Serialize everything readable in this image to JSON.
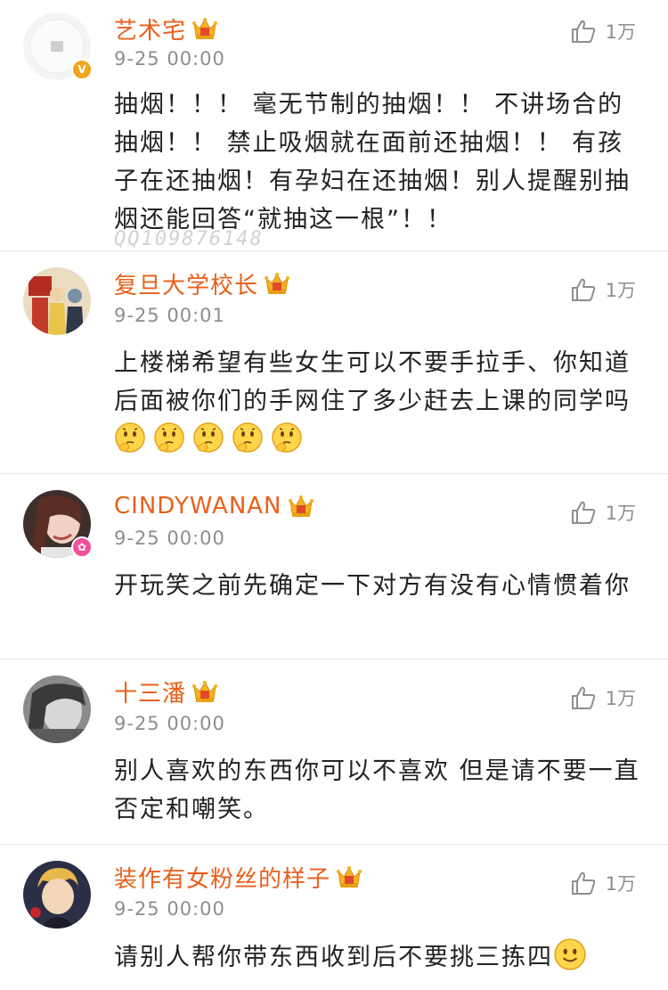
{
  "comments": [
    {
      "username": "艺术宅",
      "time": "9-25 00:00",
      "likes": "1万",
      "text": "抽烟！！！ 毫无节制的抽烟！！ 不讲场合的抽烟！！ 禁止吸烟就在面前还抽烟！！ 有孩子在还抽烟！有孕妇在还抽烟！别人提醒别抽烟还能回答“就抽这一根”！！",
      "badge_color": "#f2a51f"
    },
    {
      "username": "复旦大学校长",
      "time": "9-25 00:01",
      "likes": "1万",
      "text": "上楼梯希望有些女生可以不要手拉手、你知道后面被你们的手网住了多少赶去上课的同学吗",
      "emoji_icon": "thinking-emoji",
      "emoji_count": 5
    },
    {
      "username": "CINDYWANAN",
      "time": "9-25 00:00",
      "likes": "1万",
      "text": "开玩笑之前先确定一下对方有没有心情惯着你",
      "badge_color": "#f0509a"
    },
    {
      "username": "十三潘",
      "time": "9-25 00:00",
      "likes": "1万",
      "text": "别人喜欢的东西你可以不喜欢 但是请不要一直否定和嘲笑。"
    },
    {
      "username": "装作有女粉丝的样子",
      "time": "9-25 00:00",
      "likes": "1万",
      "text": "请别人帮你带东西收到后不要挑三拣四",
      "emoji_icon": "smile-emoji"
    }
  ],
  "watermark": "QQ109876148",
  "colors": {
    "username": "#e8601a",
    "meta": "#8e8e8e",
    "text": "#222222",
    "divider": "#e6e6e6"
  }
}
